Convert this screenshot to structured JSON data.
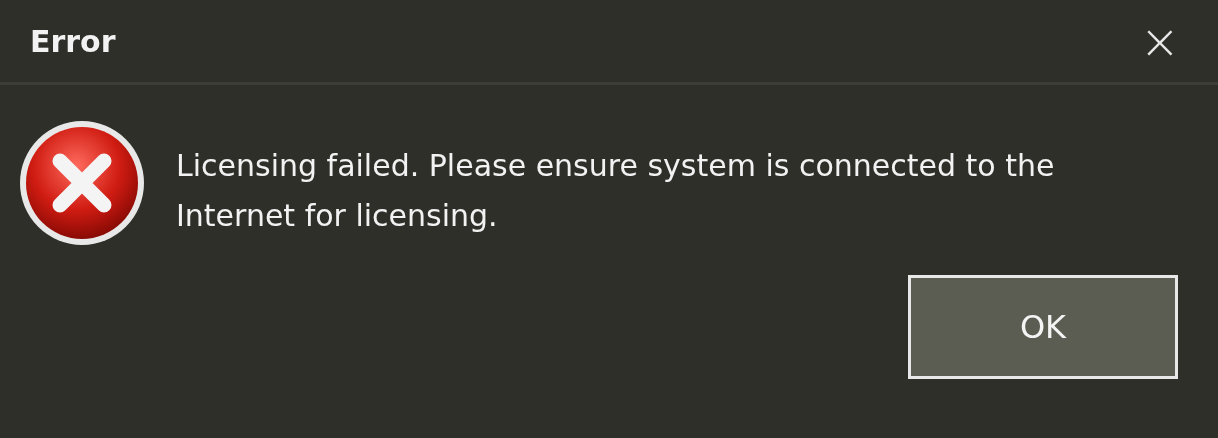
{
  "window": {
    "title": "Error",
    "close": "×"
  },
  "message": {
    "kind": "error",
    "text": "Licensing failed. Please ensure system is connected to the Internet for licensing."
  },
  "buttons": [
    {
      "label": "OK",
      "selected": true
    }
  ]
}
